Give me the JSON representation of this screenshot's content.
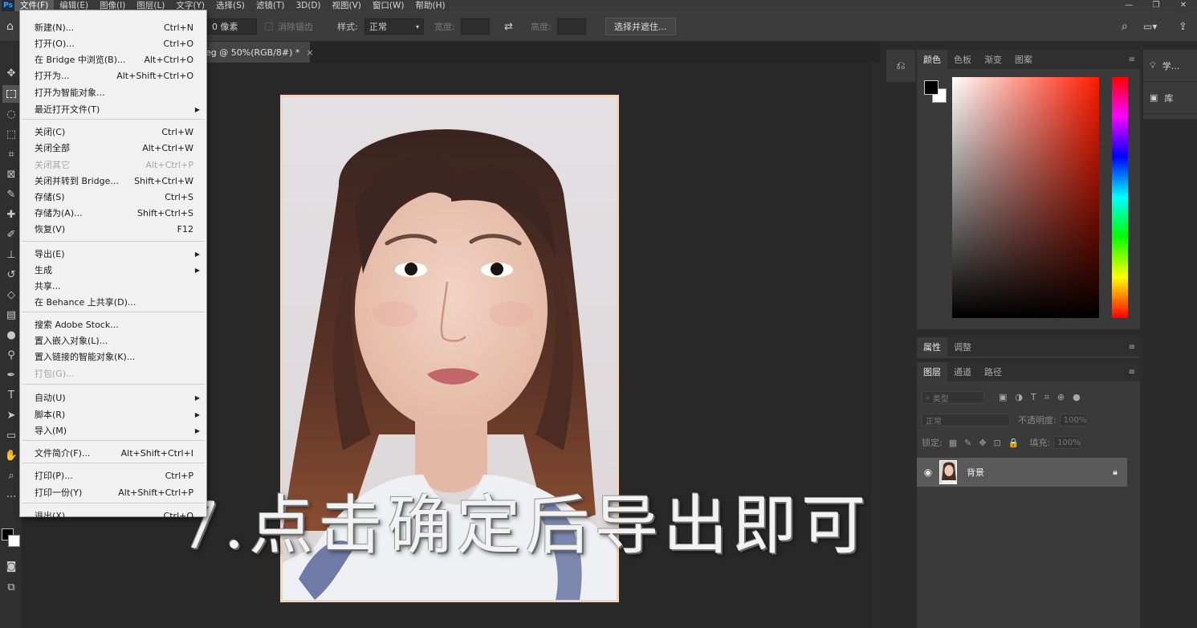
{
  "menubar": {
    "logo": "Ps",
    "items": [
      "文件(F)",
      "编辑(E)",
      "图像(I)",
      "图层(L)",
      "文字(Y)",
      "选择(S)",
      "滤镜(T)",
      "3D(D)",
      "视图(V)",
      "窗口(W)",
      "帮助(H)"
    ],
    "window_controls": [
      "—",
      "❐",
      "✕"
    ]
  },
  "options": {
    "feather_value": "0 像素",
    "anti_alias": "消除锯齿",
    "style_label": "样式:",
    "style_value": "正常",
    "width_label": "宽度:",
    "height_label": "高度:",
    "select_mask_button": "选择并遮住..."
  },
  "document": {
    "tab_title": "eg @ 50%(RGB/8#) *",
    "tab_close": "×"
  },
  "subtitle": "7.点击确定后导出即可",
  "file_menu": {
    "items": [
      {
        "label": "新建(N)...",
        "shortcut": "Ctrl+N",
        "disabled": false,
        "submenu": false
      },
      {
        "label": "打开(O)...",
        "shortcut": "Ctrl+O",
        "disabled": false,
        "submenu": false
      },
      {
        "label": "在 Bridge 中浏览(B)...",
        "shortcut": "Alt+Ctrl+O",
        "disabled": false,
        "submenu": false
      },
      {
        "label": "打开为...",
        "shortcut": "Alt+Shift+Ctrl+O",
        "disabled": false,
        "submenu": false
      },
      {
        "label": "打开为智能对象...",
        "shortcut": "",
        "disabled": false,
        "submenu": false
      },
      {
        "label": "最近打开文件(T)",
        "shortcut": "",
        "disabled": false,
        "submenu": true
      },
      {
        "label": "关闭(C)",
        "shortcut": "Ctrl+W",
        "disabled": false,
        "submenu": false
      },
      {
        "label": "关闭全部",
        "shortcut": "Alt+Ctrl+W",
        "disabled": false,
        "submenu": false
      },
      {
        "label": "关闭其它",
        "shortcut": "Alt+Ctrl+P",
        "disabled": true,
        "submenu": false
      },
      {
        "label": "关闭并转到 Bridge...",
        "shortcut": "Shift+Ctrl+W",
        "disabled": false,
        "submenu": false
      },
      {
        "label": "存储(S)",
        "shortcut": "Ctrl+S",
        "disabled": false,
        "submenu": false
      },
      {
        "label": "存储为(A)...",
        "shortcut": "Shift+Ctrl+S",
        "disabled": false,
        "submenu": false
      },
      {
        "label": "恢复(V)",
        "shortcut": "F12",
        "disabled": false,
        "submenu": false
      },
      {
        "label": "导出(E)",
        "shortcut": "",
        "disabled": false,
        "submenu": true
      },
      {
        "label": "生成",
        "shortcut": "",
        "disabled": false,
        "submenu": true
      },
      {
        "label": "共享...",
        "shortcut": "",
        "disabled": false,
        "submenu": false
      },
      {
        "label": "在 Behance 上共享(D)...",
        "shortcut": "",
        "disabled": false,
        "submenu": false
      },
      {
        "label": "搜索 Adobe Stock...",
        "shortcut": "",
        "disabled": false,
        "submenu": false
      },
      {
        "label": "置入嵌入对象(L)...",
        "shortcut": "",
        "disabled": false,
        "submenu": false
      },
      {
        "label": "置入链接的智能对象(K)...",
        "shortcut": "",
        "disabled": false,
        "submenu": false
      },
      {
        "label": "打包(G)...",
        "shortcut": "",
        "disabled": true,
        "submenu": false
      },
      {
        "label": "自动(U)",
        "shortcut": "",
        "disabled": false,
        "submenu": true
      },
      {
        "label": "脚本(R)",
        "shortcut": "",
        "disabled": false,
        "submenu": true
      },
      {
        "label": "导入(M)",
        "shortcut": "",
        "disabled": false,
        "submenu": true
      },
      {
        "label": "文件简介(F)...",
        "shortcut": "Alt+Shift+Ctrl+I",
        "disabled": false,
        "submenu": false
      },
      {
        "label": "打印(P)...",
        "shortcut": "Ctrl+P",
        "disabled": false,
        "submenu": false
      },
      {
        "label": "打印一份(Y)",
        "shortcut": "Alt+Shift+Ctrl+P",
        "disabled": false,
        "submenu": false
      },
      {
        "label": "退出(X)",
        "shortcut": "Ctrl+Q",
        "disabled": false,
        "submenu": false
      }
    ]
  },
  "color_panel": {
    "tabs": [
      "颜色",
      "色板",
      "渐变",
      "图案"
    ],
    "foreground": "#000000",
    "background": "#ffffff",
    "picker_hue": "#ff1a00"
  },
  "properties_panel": {
    "tabs": [
      "属性",
      "调整"
    ]
  },
  "layers_panel": {
    "tabs": [
      "图层",
      "通道",
      "路径"
    ],
    "filter_placeholder": "类型",
    "blend_mode": "正常",
    "opacity_label": "不透明度:",
    "opacity_value": "100%",
    "lock_label": "锁定:",
    "fill_label": "填充:",
    "fill_value": "100%",
    "layer_name": "背景"
  },
  "far_panel": {
    "items": [
      "学...",
      "库"
    ]
  }
}
